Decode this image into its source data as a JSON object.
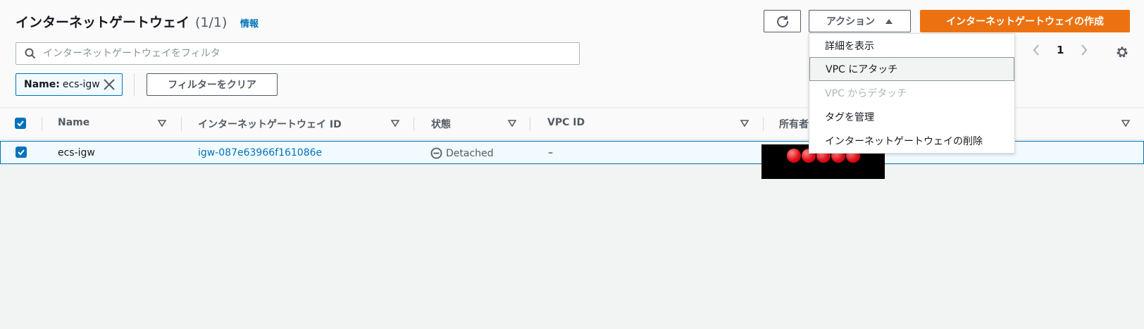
{
  "header": {
    "title": "インターネットゲートウェイ",
    "count": "(1/1)",
    "info_link": "情報"
  },
  "toolbar": {
    "refresh_icon": "refresh-icon",
    "actions_label": "アクション",
    "create_label": "インターネットゲートウェイの作成"
  },
  "search": {
    "placeholder": "インターネットゲートウェイをフィルタ"
  },
  "filter_token": {
    "key": "Name:",
    "value": "ecs-igw"
  },
  "clear_filters_label": "フィルターをクリア",
  "pagination": {
    "page": "1"
  },
  "table": {
    "columns": [
      "Name",
      "インターネットゲートウェイ ID",
      "状態",
      "VPC ID",
      "所有者"
    ],
    "rows": [
      {
        "name": "ecs-igw",
        "id": "igw-087e63966f161086e",
        "status": "Detached",
        "vpc_id": "–"
      }
    ]
  },
  "actions_menu": {
    "items": [
      {
        "label": "詳細を表示"
      },
      {
        "label": "VPC にアタッチ"
      },
      {
        "label": "VPC からデタッチ"
      },
      {
        "label": "タグを管理"
      },
      {
        "label": "インターネットゲートウェイの削除"
      }
    ]
  },
  "colors": {
    "accent": "#0073bb",
    "primary_button": "#ec7211",
    "redaction": "#000000"
  }
}
